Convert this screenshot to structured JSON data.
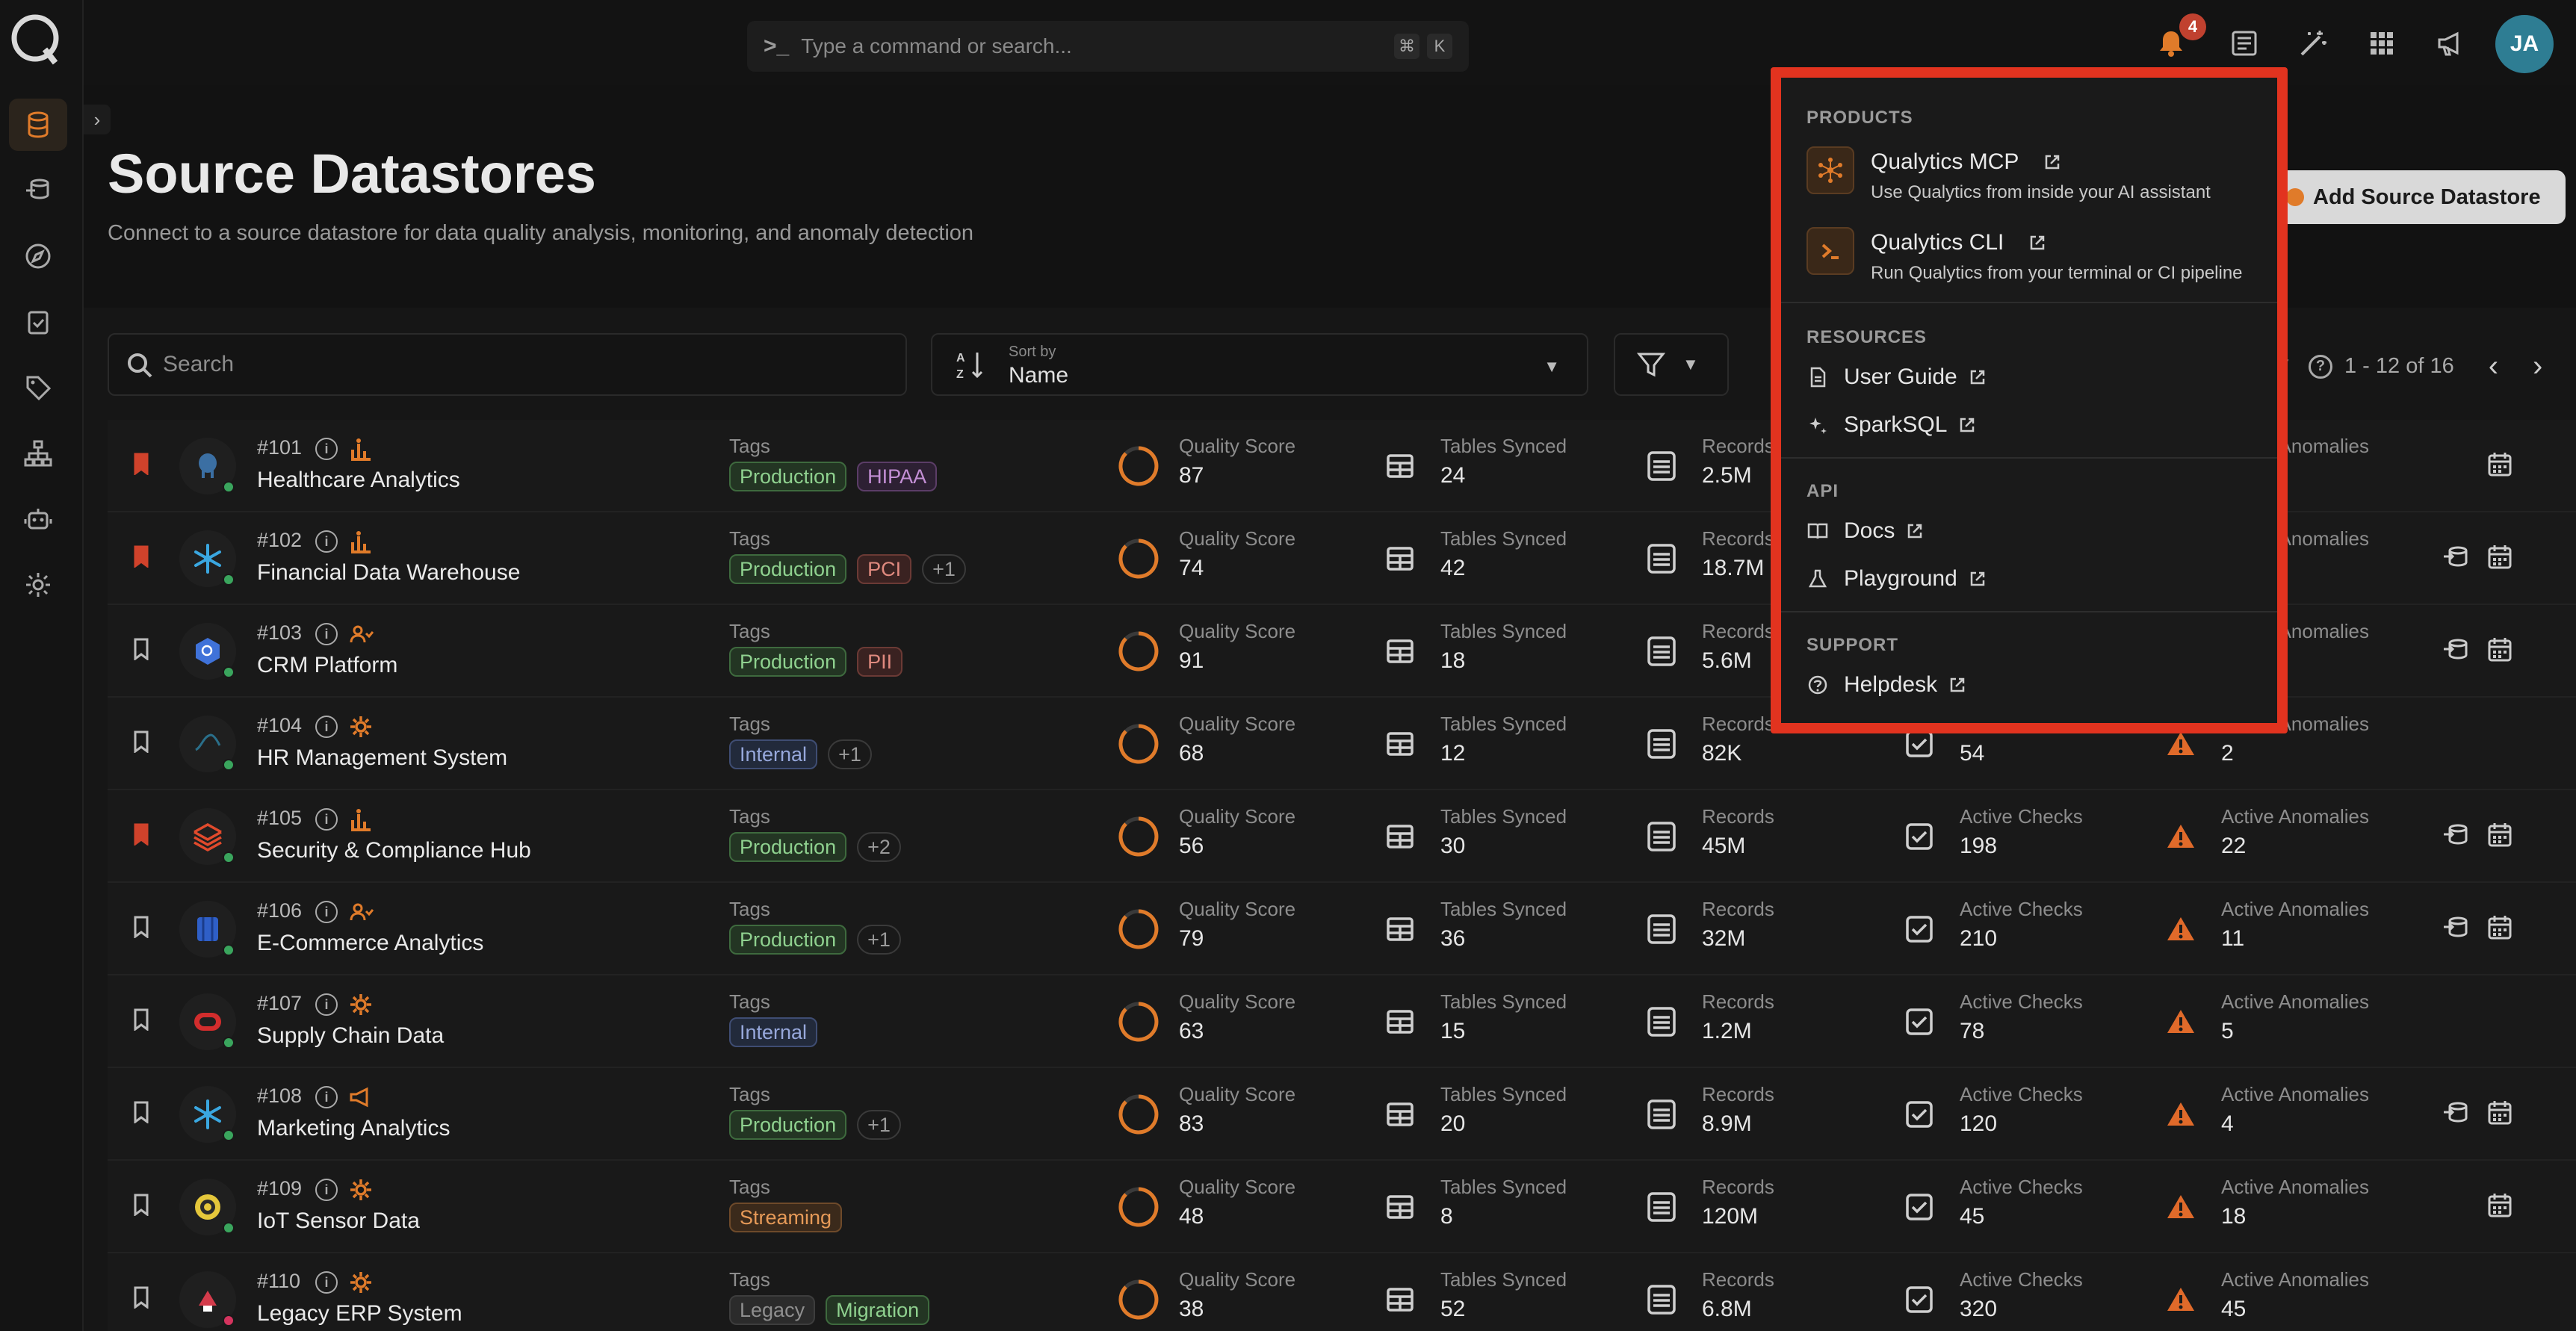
{
  "command_bar": {
    "placeholder": "Type a command or search...",
    "key1": "⌘",
    "key2": "K"
  },
  "notifications": {
    "count": "4"
  },
  "user": {
    "initials": "JA"
  },
  "page": {
    "title": "Source Datastores",
    "subtitle": "Connect to a source datastore for data quality analysis, monitoring, and anomaly detection",
    "add_button": "Add Source Datastore"
  },
  "toolbar": {
    "search_placeholder": "Search",
    "sort_label": "Sort by",
    "sort_value": "Name",
    "pagination": "1 - 12 of 16"
  },
  "labels": {
    "tags": "Tags",
    "quality_score": "Quality Score",
    "tables_synced": "Tables Synced",
    "records": "Records",
    "active_checks": "Active Checks",
    "active_anomalies": "Active Anomalies"
  },
  "rows": [
    {
      "id": "#101",
      "name": "Healthcare Analytics",
      "tags": [
        {
          "t": "Production",
          "c": "green"
        },
        {
          "t": "HIPAA",
          "c": "purple"
        }
      ],
      "quality": "87",
      "tables": "24",
      "records": "2.5M",
      "checks": "",
      "anomalies": "",
      "bookmarked": true,
      "icon": "postgres",
      "type": "chart",
      "actions": [
        "calendar"
      ]
    },
    {
      "id": "#102",
      "name": "Financial Data Warehouse",
      "tags": [
        {
          "t": "Production",
          "c": "green"
        },
        {
          "t": "PCI",
          "c": "red"
        },
        {
          "t": "+1",
          "c": "more"
        }
      ],
      "quality": "74",
      "tables": "42",
      "records": "18.7M",
      "checks": "",
      "anomalies": "",
      "bookmarked": true,
      "icon": "snowflake",
      "type": "chart",
      "actions": [
        "sync",
        "calendar"
      ]
    },
    {
      "id": "#103",
      "name": "CRM Platform",
      "tags": [
        {
          "t": "Production",
          "c": "green"
        },
        {
          "t": "PII",
          "c": "red"
        }
      ],
      "quality": "91",
      "tables": "18",
      "records": "5.6M",
      "checks": "",
      "anomalies": "",
      "bookmarked": false,
      "icon": "bigquery",
      "type": "user",
      "actions": [
        "sync",
        "calendar"
      ]
    },
    {
      "id": "#104",
      "name": "HR Management System",
      "tags": [
        {
          "t": "Internal",
          "c": "blue"
        },
        {
          "t": "+1",
          "c": "more"
        }
      ],
      "quality": "68",
      "tables": "12",
      "records": "82K",
      "checks": "54",
      "anomalies": "2",
      "bookmarked": false,
      "icon": "mysql",
      "type": "gear",
      "actions": []
    },
    {
      "id": "#105",
      "name": "Security & Compliance Hub",
      "tags": [
        {
          "t": "Production",
          "c": "green"
        },
        {
          "t": "+2",
          "c": "more"
        }
      ],
      "quality": "56",
      "tables": "30",
      "records": "45M",
      "checks": "198",
      "anomalies": "22",
      "bookmarked": true,
      "icon": "databricks",
      "type": "chart",
      "actions": [
        "sync",
        "calendar"
      ]
    },
    {
      "id": "#106",
      "name": "E-Commerce Analytics",
      "tags": [
        {
          "t": "Production",
          "c": "green"
        },
        {
          "t": "+1",
          "c": "more"
        }
      ],
      "quality": "79",
      "tables": "36",
      "records": "32M",
      "checks": "210",
      "anomalies": "11",
      "bookmarked": false,
      "icon": "redshift",
      "type": "user",
      "actions": [
        "sync",
        "calendar"
      ]
    },
    {
      "id": "#107",
      "name": "Supply Chain Data",
      "tags": [
        {
          "t": "Internal",
          "c": "blue"
        }
      ],
      "quality": "63",
      "tables": "15",
      "records": "1.2M",
      "checks": "78",
      "anomalies": "5",
      "bookmarked": false,
      "icon": "oracle",
      "type": "gear",
      "actions": []
    },
    {
      "id": "#108",
      "name": "Marketing Analytics",
      "tags": [
        {
          "t": "Production",
          "c": "green"
        },
        {
          "t": "+1",
          "c": "more"
        }
      ],
      "quality": "83",
      "tables": "20",
      "records": "8.9M",
      "checks": "120",
      "anomalies": "4",
      "bookmarked": false,
      "icon": "snowflake",
      "type": "megaphone",
      "actions": [
        "sync",
        "calendar"
      ]
    },
    {
      "id": "#109",
      "name": "IoT Sensor Data",
      "tags": [
        {
          "t": "Streaming",
          "c": "orange"
        }
      ],
      "quality": "48",
      "tables": "8",
      "records": "120M",
      "checks": "45",
      "anomalies": "18",
      "bookmarked": false,
      "icon": "hive",
      "type": "gear",
      "actions": [
        "calendar"
      ]
    },
    {
      "id": "#110",
      "name": "Legacy ERP System",
      "tags": [
        {
          "t": "Legacy",
          "c": "gray"
        },
        {
          "t": "Migration",
          "c": "green"
        }
      ],
      "quality": "38",
      "tables": "52",
      "records": "6.8M",
      "checks": "320",
      "anomalies": "45",
      "bookmarked": false,
      "icon": "db2",
      "type": "gear",
      "actions": [],
      "pink": true
    }
  ],
  "dropdown": {
    "products_title": "PRODUCTS",
    "mcp_title": "Qualytics MCP",
    "mcp_desc": "Use Qualytics from inside your AI assistant",
    "cli_title": "Qualytics CLI",
    "cli_desc": "Run Qualytics from your terminal or CI pipeline",
    "resources_title": "RESOURCES",
    "user_guide": "User Guide",
    "sparksql": "SparkSQL",
    "api_title": "API",
    "docs": "Docs",
    "playground": "Playground",
    "support_title": "SUPPORT",
    "helpdesk": "Helpdesk"
  },
  "colors": {
    "accent": "#e07b2a",
    "highlight": "#e2331f",
    "danger_icon": "#e06a2a"
  }
}
